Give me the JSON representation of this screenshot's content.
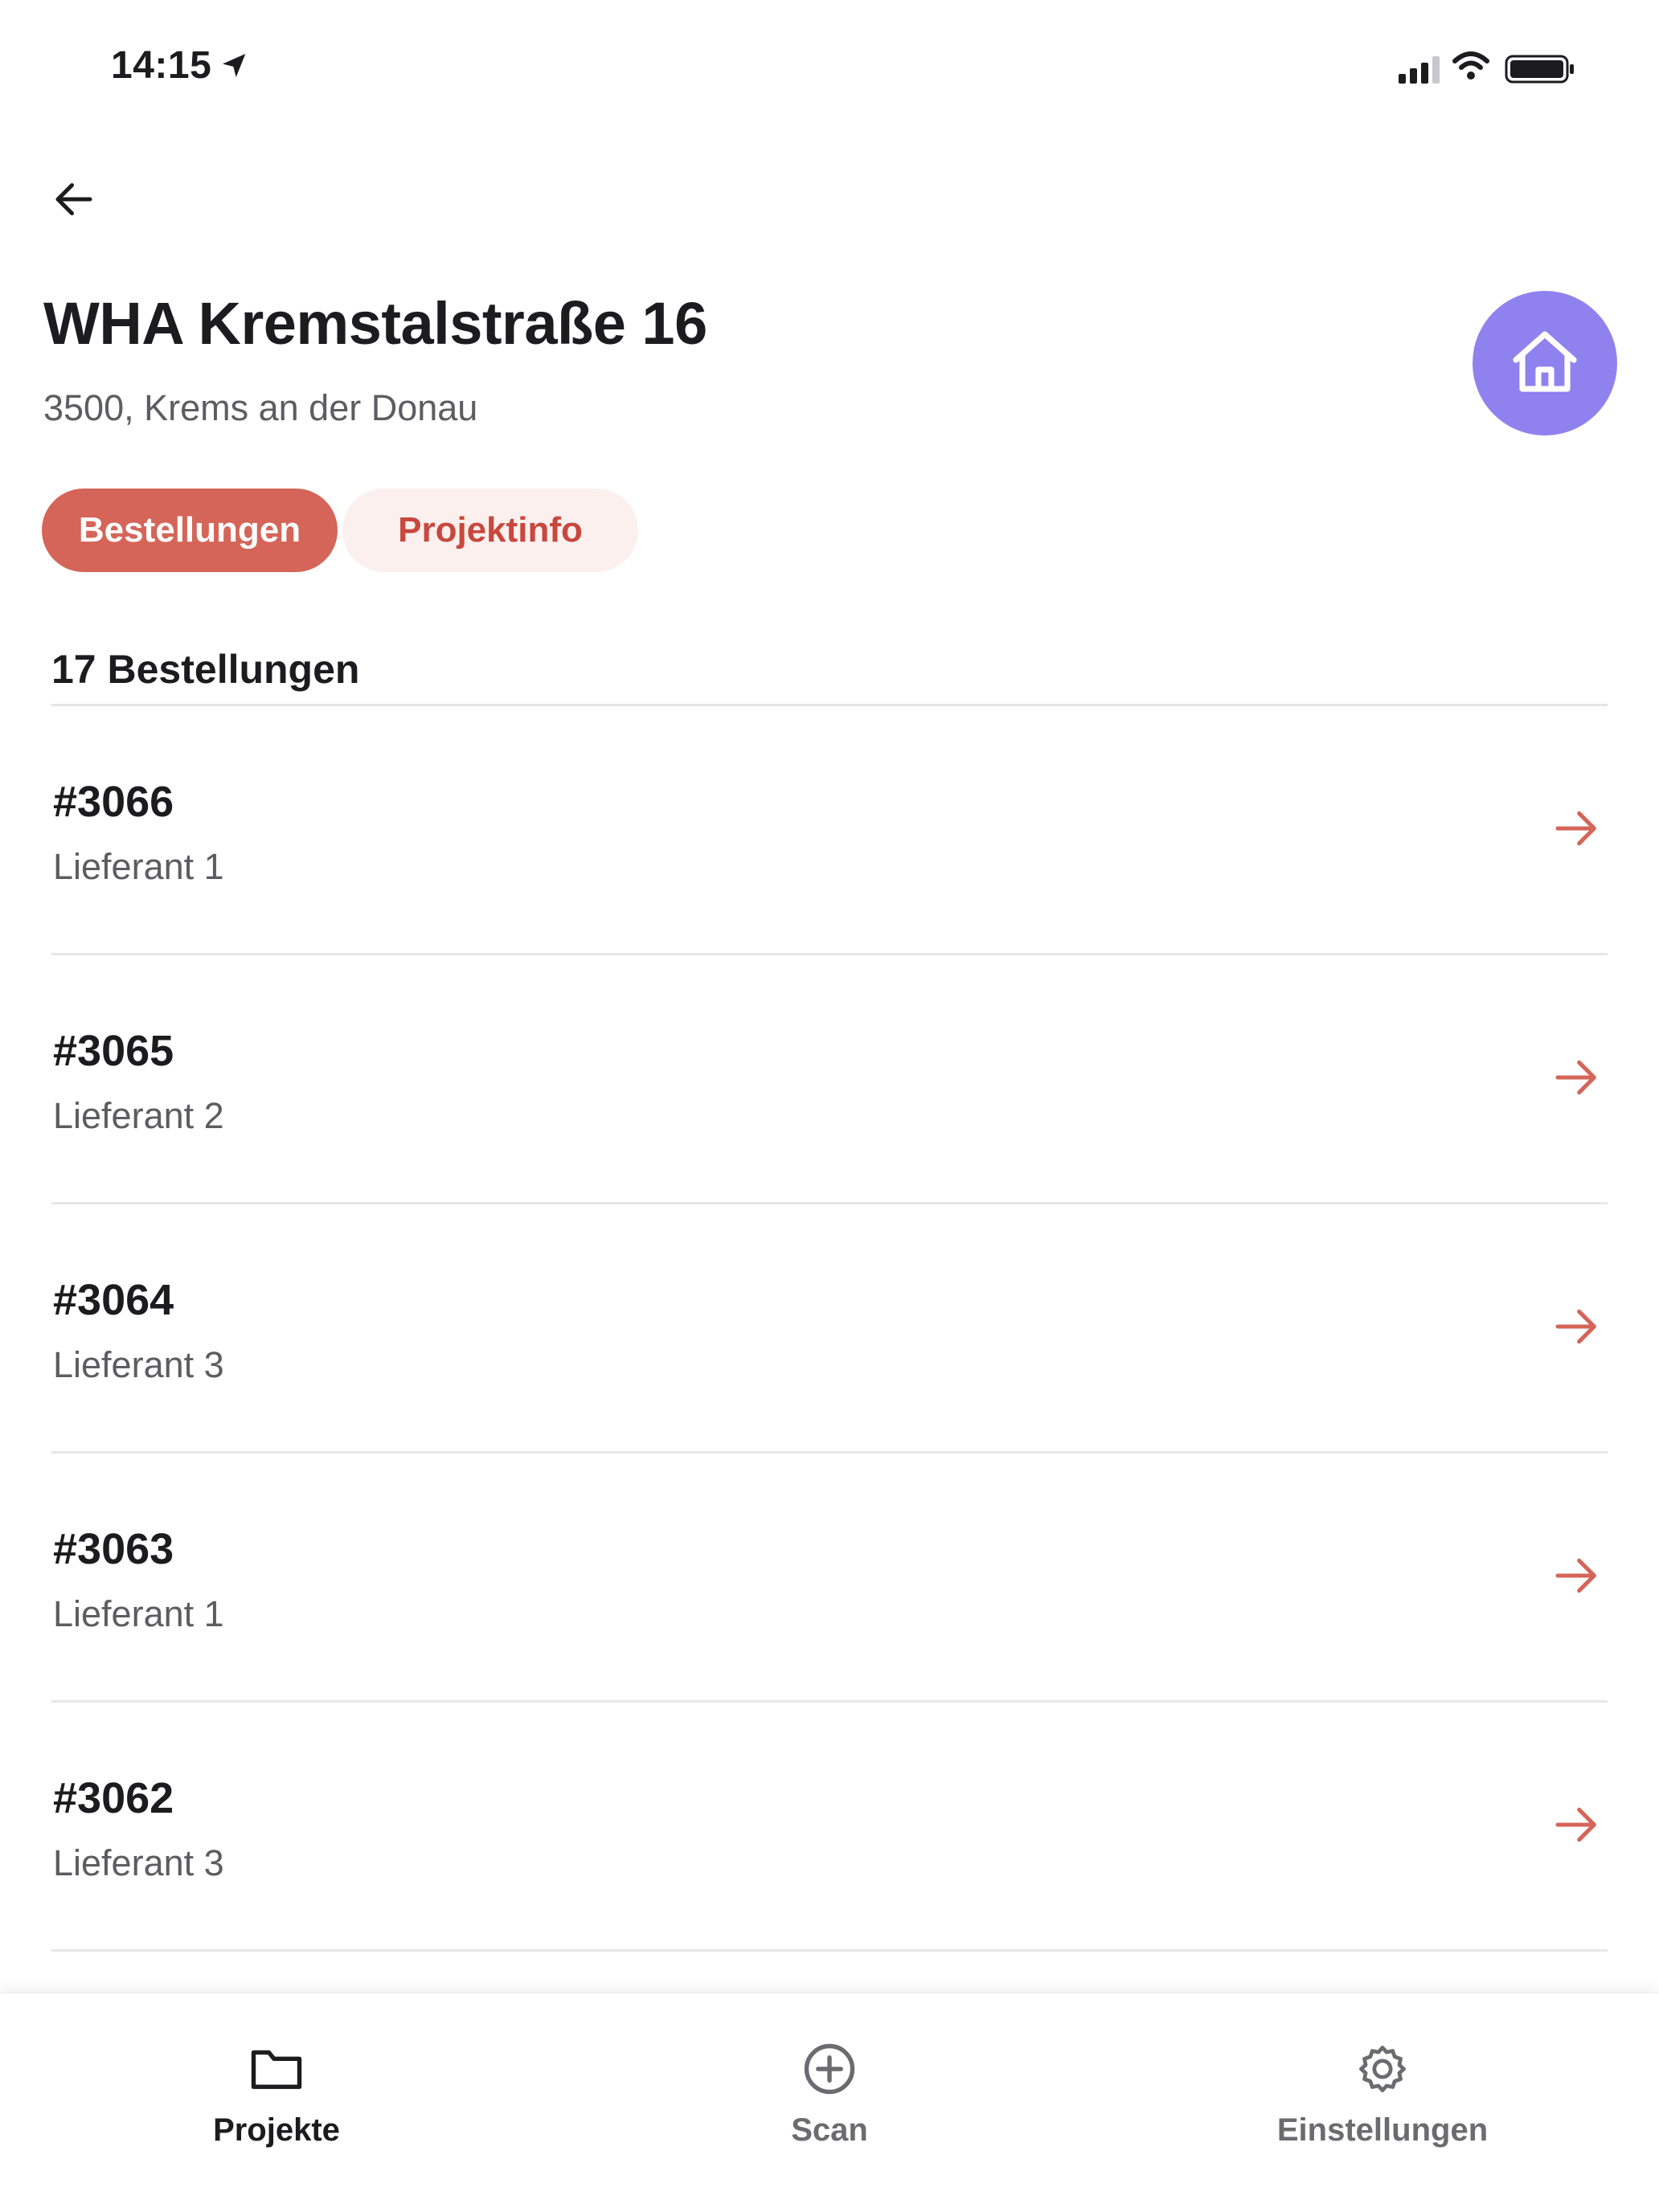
{
  "status_bar": {
    "time": "14:15"
  },
  "project": {
    "title": "WHA Kremstalstraße 16",
    "subtitle": "3500, Krems an der Donau"
  },
  "tabs": [
    {
      "label": "Bestellungen",
      "active": true
    },
    {
      "label": "Projektinfo",
      "active": false
    }
  ],
  "orders": {
    "count_label": "17 Bestellungen",
    "items": [
      {
        "number": "#3066",
        "supplier": "Lieferant 1"
      },
      {
        "number": "#3065",
        "supplier": "Lieferant 2"
      },
      {
        "number": "#3064",
        "supplier": "Lieferant 3"
      },
      {
        "number": "#3063",
        "supplier": "Lieferant 1"
      },
      {
        "number": "#3062",
        "supplier": "Lieferant 3"
      }
    ]
  },
  "bottom_nav": [
    {
      "label": "Projekte",
      "icon": "folder-icon",
      "active": true
    },
    {
      "label": "Scan",
      "icon": "plus-circle-icon",
      "active": false
    },
    {
      "label": "Einstellungen",
      "icon": "gear-icon",
      "active": false
    }
  ],
  "colors": {
    "accent": "#d56559",
    "accent_light": "#fcf0ef",
    "avatar": "#8f82ee",
    "arrow": "#d56559"
  }
}
